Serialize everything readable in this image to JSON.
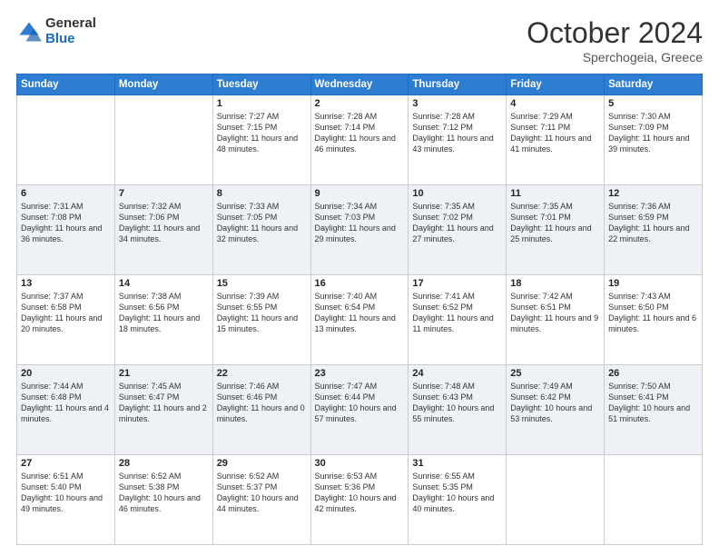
{
  "header": {
    "logo_general": "General",
    "logo_blue": "Blue",
    "month_title": "October 2024",
    "location": "Sperchogeia, Greece"
  },
  "days_of_week": [
    "Sunday",
    "Monday",
    "Tuesday",
    "Wednesday",
    "Thursday",
    "Friday",
    "Saturday"
  ],
  "weeks": [
    [
      {
        "day": "",
        "info": ""
      },
      {
        "day": "",
        "info": ""
      },
      {
        "day": "1",
        "info": "Sunrise: 7:27 AM\nSunset: 7:15 PM\nDaylight: 11 hours and 48 minutes."
      },
      {
        "day": "2",
        "info": "Sunrise: 7:28 AM\nSunset: 7:14 PM\nDaylight: 11 hours and 46 minutes."
      },
      {
        "day": "3",
        "info": "Sunrise: 7:28 AM\nSunset: 7:12 PM\nDaylight: 11 hours and 43 minutes."
      },
      {
        "day": "4",
        "info": "Sunrise: 7:29 AM\nSunset: 7:11 PM\nDaylight: 11 hours and 41 minutes."
      },
      {
        "day": "5",
        "info": "Sunrise: 7:30 AM\nSunset: 7:09 PM\nDaylight: 11 hours and 39 minutes."
      }
    ],
    [
      {
        "day": "6",
        "info": "Sunrise: 7:31 AM\nSunset: 7:08 PM\nDaylight: 11 hours and 36 minutes."
      },
      {
        "day": "7",
        "info": "Sunrise: 7:32 AM\nSunset: 7:06 PM\nDaylight: 11 hours and 34 minutes."
      },
      {
        "day": "8",
        "info": "Sunrise: 7:33 AM\nSunset: 7:05 PM\nDaylight: 11 hours and 32 minutes."
      },
      {
        "day": "9",
        "info": "Sunrise: 7:34 AM\nSunset: 7:03 PM\nDaylight: 11 hours and 29 minutes."
      },
      {
        "day": "10",
        "info": "Sunrise: 7:35 AM\nSunset: 7:02 PM\nDaylight: 11 hours and 27 minutes."
      },
      {
        "day": "11",
        "info": "Sunrise: 7:35 AM\nSunset: 7:01 PM\nDaylight: 11 hours and 25 minutes."
      },
      {
        "day": "12",
        "info": "Sunrise: 7:36 AM\nSunset: 6:59 PM\nDaylight: 11 hours and 22 minutes."
      }
    ],
    [
      {
        "day": "13",
        "info": "Sunrise: 7:37 AM\nSunset: 6:58 PM\nDaylight: 11 hours and 20 minutes."
      },
      {
        "day": "14",
        "info": "Sunrise: 7:38 AM\nSunset: 6:56 PM\nDaylight: 11 hours and 18 minutes."
      },
      {
        "day": "15",
        "info": "Sunrise: 7:39 AM\nSunset: 6:55 PM\nDaylight: 11 hours and 15 minutes."
      },
      {
        "day": "16",
        "info": "Sunrise: 7:40 AM\nSunset: 6:54 PM\nDaylight: 11 hours and 13 minutes."
      },
      {
        "day": "17",
        "info": "Sunrise: 7:41 AM\nSunset: 6:52 PM\nDaylight: 11 hours and 11 minutes."
      },
      {
        "day": "18",
        "info": "Sunrise: 7:42 AM\nSunset: 6:51 PM\nDaylight: 11 hours and 9 minutes."
      },
      {
        "day": "19",
        "info": "Sunrise: 7:43 AM\nSunset: 6:50 PM\nDaylight: 11 hours and 6 minutes."
      }
    ],
    [
      {
        "day": "20",
        "info": "Sunrise: 7:44 AM\nSunset: 6:48 PM\nDaylight: 11 hours and 4 minutes."
      },
      {
        "day": "21",
        "info": "Sunrise: 7:45 AM\nSunset: 6:47 PM\nDaylight: 11 hours and 2 minutes."
      },
      {
        "day": "22",
        "info": "Sunrise: 7:46 AM\nSunset: 6:46 PM\nDaylight: 11 hours and 0 minutes."
      },
      {
        "day": "23",
        "info": "Sunrise: 7:47 AM\nSunset: 6:44 PM\nDaylight: 10 hours and 57 minutes."
      },
      {
        "day": "24",
        "info": "Sunrise: 7:48 AM\nSunset: 6:43 PM\nDaylight: 10 hours and 55 minutes."
      },
      {
        "day": "25",
        "info": "Sunrise: 7:49 AM\nSunset: 6:42 PM\nDaylight: 10 hours and 53 minutes."
      },
      {
        "day": "26",
        "info": "Sunrise: 7:50 AM\nSunset: 6:41 PM\nDaylight: 10 hours and 51 minutes."
      }
    ],
    [
      {
        "day": "27",
        "info": "Sunrise: 6:51 AM\nSunset: 5:40 PM\nDaylight: 10 hours and 49 minutes."
      },
      {
        "day": "28",
        "info": "Sunrise: 6:52 AM\nSunset: 5:38 PM\nDaylight: 10 hours and 46 minutes."
      },
      {
        "day": "29",
        "info": "Sunrise: 6:52 AM\nSunset: 5:37 PM\nDaylight: 10 hours and 44 minutes."
      },
      {
        "day": "30",
        "info": "Sunrise: 6:53 AM\nSunset: 5:36 PM\nDaylight: 10 hours and 42 minutes."
      },
      {
        "day": "31",
        "info": "Sunrise: 6:55 AM\nSunset: 5:35 PM\nDaylight: 10 hours and 40 minutes."
      },
      {
        "day": "",
        "info": ""
      },
      {
        "day": "",
        "info": ""
      }
    ]
  ]
}
